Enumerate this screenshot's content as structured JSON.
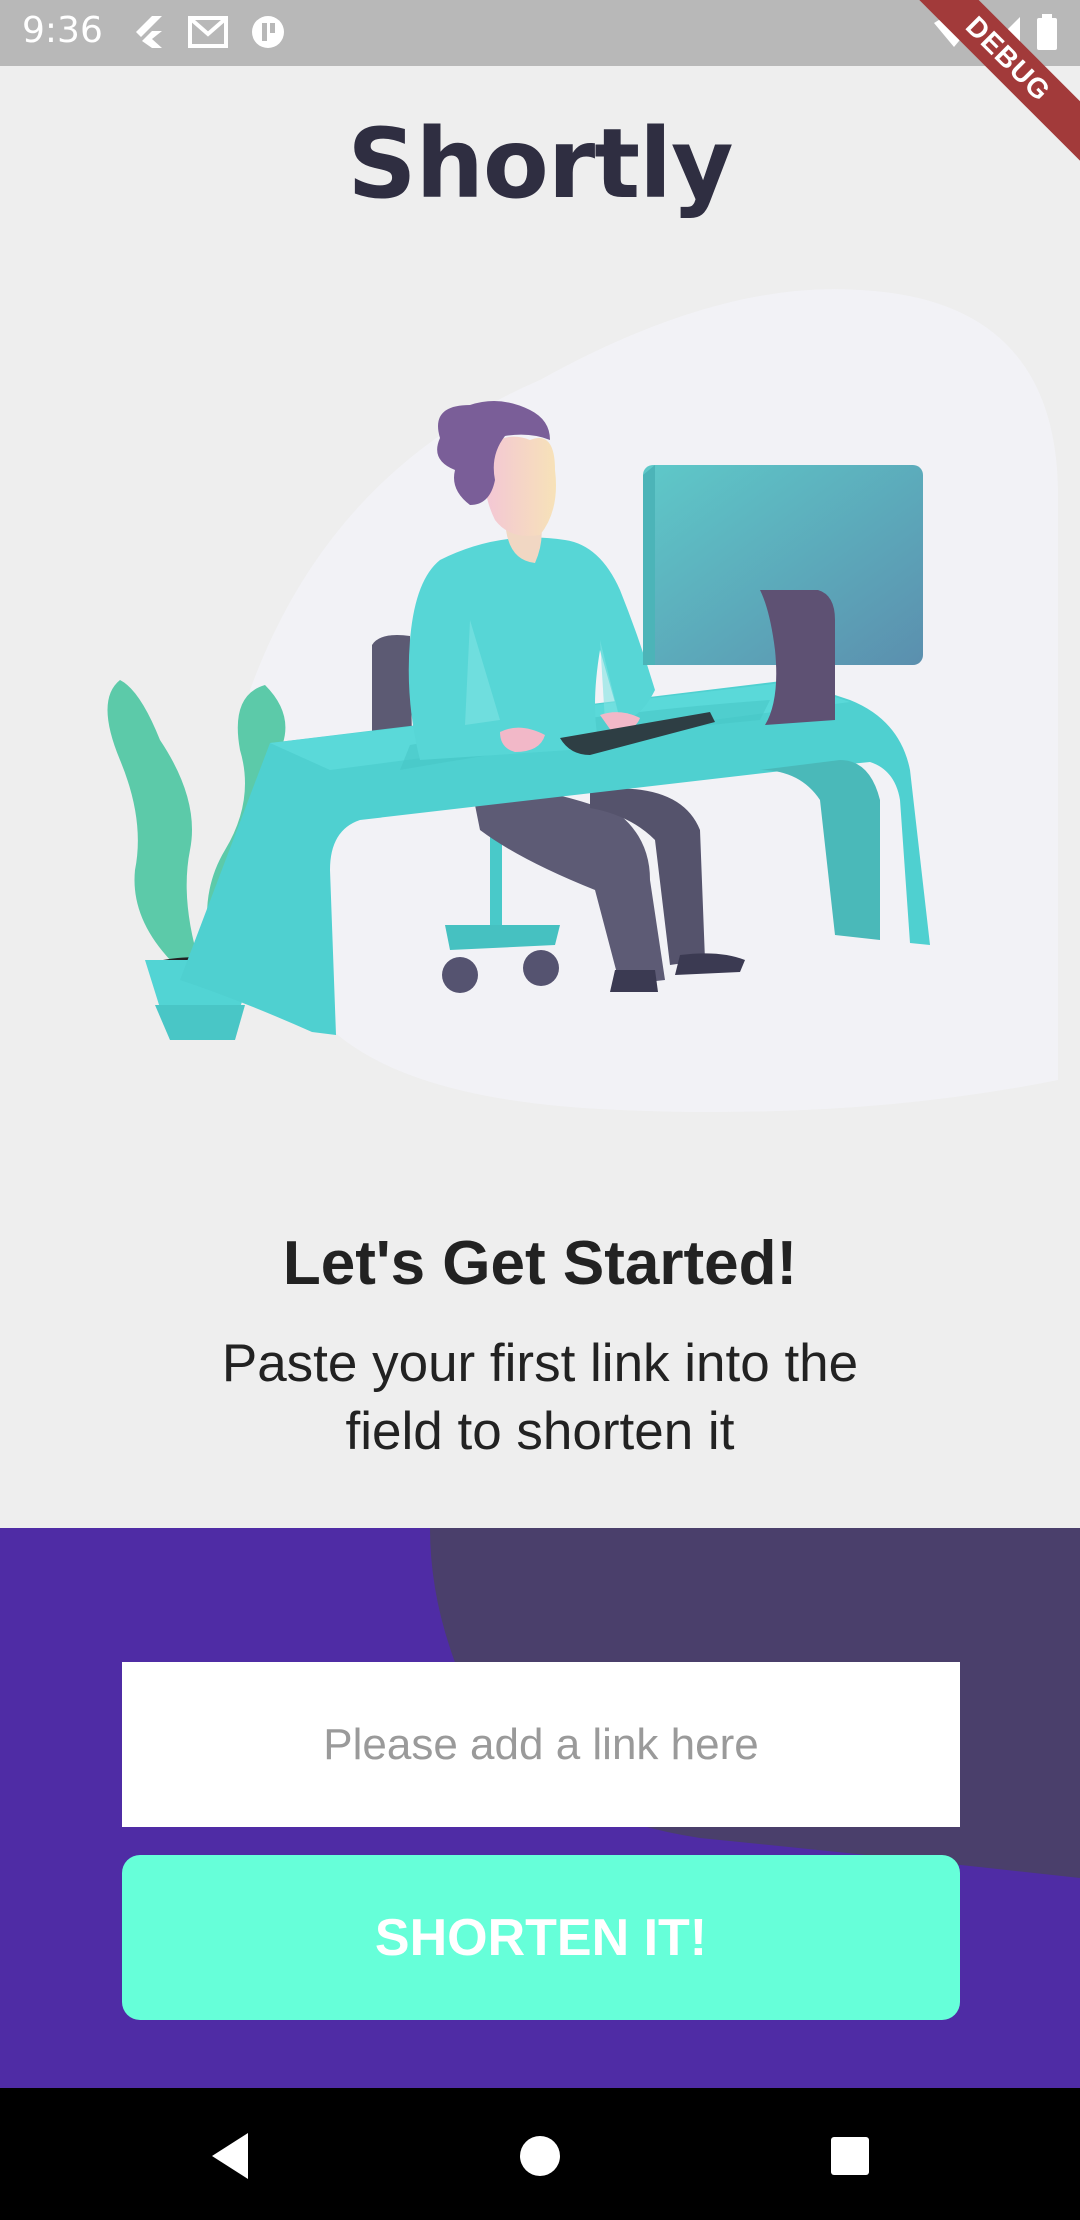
{
  "status_bar": {
    "time": "9:36",
    "left_icons": [
      "flutter-icon",
      "gmail-icon",
      "app-notification-icon"
    ],
    "right_icons": [
      "wifi-icon",
      "signal-icon",
      "battery-icon"
    ]
  },
  "debug_banner": "DEBUG",
  "app": {
    "title": "Shortly",
    "illustration": "person-working-at-desk-illustration"
  },
  "onboarding": {
    "heading": "Let's Get Started!",
    "description": "Paste your first link into the field to shorten it"
  },
  "form": {
    "input_placeholder": "Please add a link here",
    "input_value": "",
    "button_label": "SHORTEN IT!"
  },
  "nav_bar": {
    "buttons": [
      "back-icon",
      "home-icon",
      "recents-icon"
    ]
  },
  "colors": {
    "title": "#2f2e41",
    "panel_primary": "#4f2ca5",
    "panel_secondary": "#4a3f6b",
    "button": "#66ffd9",
    "illustration_accent": "#54d6d6"
  }
}
